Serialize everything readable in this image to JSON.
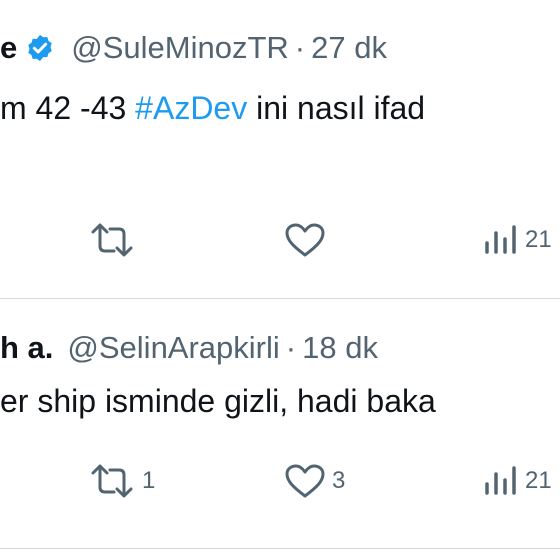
{
  "tweets": [
    {
      "name_fragment": "e",
      "verified": true,
      "handle": "@SuleMinozTR",
      "separator": "·",
      "time": "27 dk",
      "text_before": "m 42 -43 ",
      "hashtag": "#AzDev",
      "text_after": " ini nasıl ifad",
      "actions": {
        "reply_icon": "reply-icon",
        "retweet_icon": "retweet-icon",
        "retweet_count": "",
        "like_icon": "heart-icon",
        "like_count": "",
        "views_icon": "views-icon",
        "views_count": "21"
      }
    },
    {
      "name_fragment": "h a.",
      "verified": false,
      "handle": "@SelinArapkirli",
      "separator": "·",
      "time": "18 dk",
      "text": "er ship isminde gizli, hadi baka",
      "actions": {
        "retweet_icon": "retweet-icon",
        "retweet_count": "1",
        "like_icon": "heart-icon",
        "like_count": "3",
        "views_icon": "views-icon",
        "views_count": "21"
      }
    }
  ],
  "colors": {
    "link": "#1d9bf0",
    "secondary_text": "#536471",
    "verified_badge": "#1d9bf0"
  }
}
